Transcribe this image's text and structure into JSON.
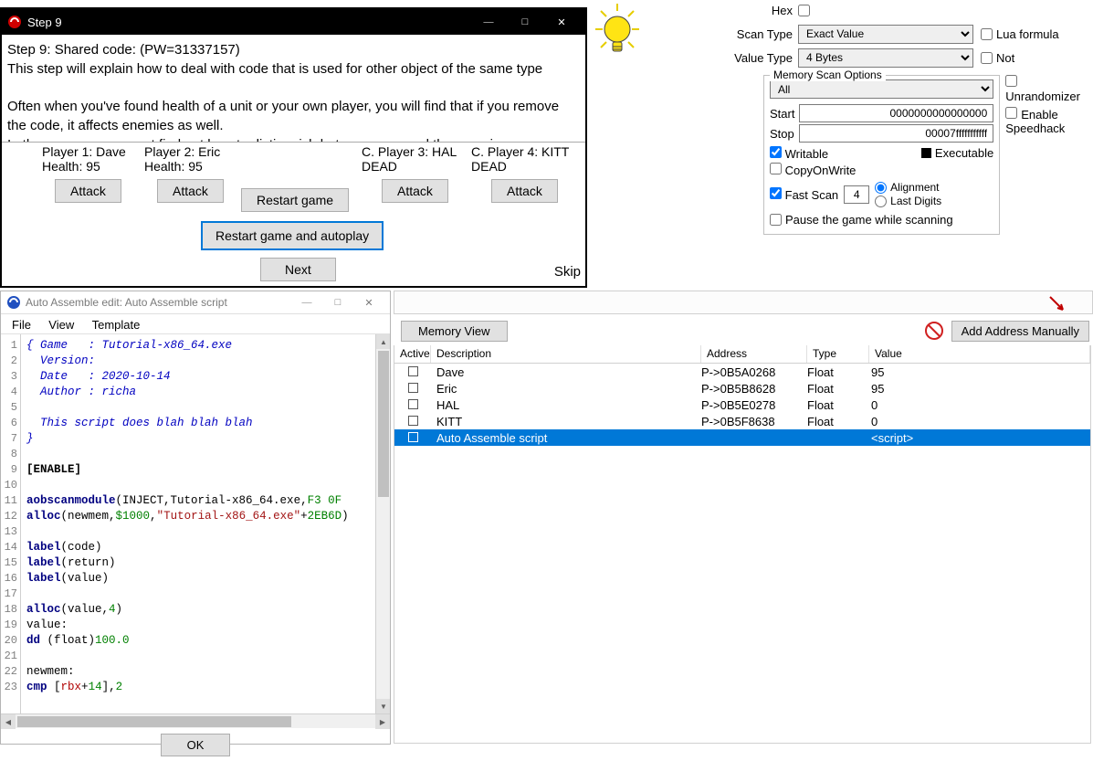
{
  "step9": {
    "title": "Step 9",
    "desc_line1": "Step 9: Shared code: (PW=31337157)",
    "desc_line2": "This step will explain how to deal with code that is used for other object of the same type",
    "desc_line3": "",
    "desc_line4": "Often when you've found health of a unit or your own player, you will find that if you remove the code, it affects enemies as well.",
    "desc_line5": "In these cases you must find out how to distinguish between your and the enemies",
    "players": [
      {
        "label": "Player 1: Dave",
        "health": "Health: 95",
        "btn": "Attack"
      },
      {
        "label": "Player 2: Eric",
        "health": "Health: 95",
        "btn": "Attack"
      },
      {
        "label": "C. Player 3: HAL",
        "health": "DEAD",
        "btn": "Attack"
      },
      {
        "label": "C. Player 4: KITT",
        "health": "DEAD",
        "btn": "Attack"
      }
    ],
    "restart": "Restart game",
    "restart_auto": "Restart game and autoplay",
    "next": "Next",
    "skip": "Skip"
  },
  "asm": {
    "title": "Auto Assemble edit: Auto Assemble script",
    "menu": [
      "File",
      "View",
      "Template"
    ],
    "ok": "OK",
    "lines": [
      {
        "n": 1,
        "cls": "c-blue",
        "t": "{ Game   : Tutorial-x86_64.exe"
      },
      {
        "n": 2,
        "cls": "c-blue",
        "t": "  Version:"
      },
      {
        "n": 3,
        "cls": "c-blue",
        "t": "  Date   : 2020-10-14"
      },
      {
        "n": 4,
        "cls": "c-blue",
        "t": "  Author : richa"
      },
      {
        "n": 5,
        "cls": "",
        "t": ""
      },
      {
        "n": 6,
        "cls": "c-blue",
        "t": "  This script does blah blah blah"
      },
      {
        "n": 7,
        "cls": "c-blue",
        "t": "}"
      },
      {
        "n": 8,
        "cls": "",
        "t": ""
      },
      {
        "n": 9,
        "cls": "c-bold",
        "t": "[ENABLE]"
      },
      {
        "n": 10,
        "cls": "",
        "t": ""
      },
      {
        "n": 11,
        "html": "<span class='c-kw'>aobscanmodule</span>(INJECT,Tutorial-x86_64.exe,<span class='c-num'>F3 0F</span>"
      },
      {
        "n": 12,
        "html": "<span class='c-kw'>alloc</span>(newmem,<span class='c-num'>$1000</span>,<span class='c-str'>\"Tutorial-x86_64.exe\"</span>+<span class='c-num'>2EB6D</span>)"
      },
      {
        "n": 13,
        "cls": "",
        "t": ""
      },
      {
        "n": 14,
        "html": "<span class='c-kw'>label</span>(code)"
      },
      {
        "n": 15,
        "html": "<span class='c-kw'>label</span>(return)"
      },
      {
        "n": 16,
        "html": "<span class='c-kw'>label</span>(value)"
      },
      {
        "n": 17,
        "cls": "",
        "t": ""
      },
      {
        "n": 18,
        "html": "<span class='c-kw'>alloc</span>(value,<span class='c-num'>4</span>)"
      },
      {
        "n": 19,
        "html": "value:"
      },
      {
        "n": 20,
        "html": "<span class='c-kw'>dd</span> (float)<span class='c-num'>100.0</span>"
      },
      {
        "n": 21,
        "cls": "",
        "t": ""
      },
      {
        "n": 22,
        "html": "newmem:"
      },
      {
        "n": 23,
        "html": "<span class='c-kw'>cmp</span> [<span style='color:#b00000'>rbx</span>+<span class='c-num'>14</span>],<span class='c-num'>2</span>"
      }
    ]
  },
  "scan": {
    "hex": "Hex",
    "scan_type_lbl": "Scan Type",
    "scan_type_val": "Exact Value",
    "value_type_lbl": "Value Type",
    "value_type_val": "4 Bytes",
    "lua": "Lua formula",
    "not": "Not",
    "memopt_legend": "Memory Scan Options",
    "all": "All",
    "start_lbl": "Start",
    "start_val": "0000000000000000",
    "stop_lbl": "Stop",
    "stop_val": "00007fffffffffff",
    "writable": "Writable",
    "executable": "Executable",
    "cow": "CopyOnWrite",
    "fast": "Fast Scan",
    "fast_val": "4",
    "alignment": "Alignment",
    "lastdigits": "Last Digits",
    "pause": "Pause the game while scanning",
    "unrandom": "Unrandomizer",
    "speedhack": "Enable Speedhack"
  },
  "btnrow": {
    "memview": "Memory View",
    "addman": "Add Address Manually"
  },
  "table": {
    "hdr": {
      "active": "Active",
      "desc": "Description",
      "addr": "Address",
      "type": "Type",
      "val": "Value"
    },
    "rows": [
      {
        "desc": "Dave",
        "addr": "P->0B5A0268",
        "type": "Float",
        "val": "95",
        "sel": false
      },
      {
        "desc": "Eric",
        "addr": "P->0B5B8628",
        "type": "Float",
        "val": "95",
        "sel": false
      },
      {
        "desc": "HAL",
        "addr": "P->0B5E0278",
        "type": "Float",
        "val": "0",
        "sel": false
      },
      {
        "desc": "KITT",
        "addr": "P->0B5F8638",
        "type": "Float",
        "val": "0",
        "sel": false
      },
      {
        "desc": "Auto Assemble script",
        "addr": "",
        "type": "",
        "val": "<script>",
        "sel": true
      }
    ]
  }
}
